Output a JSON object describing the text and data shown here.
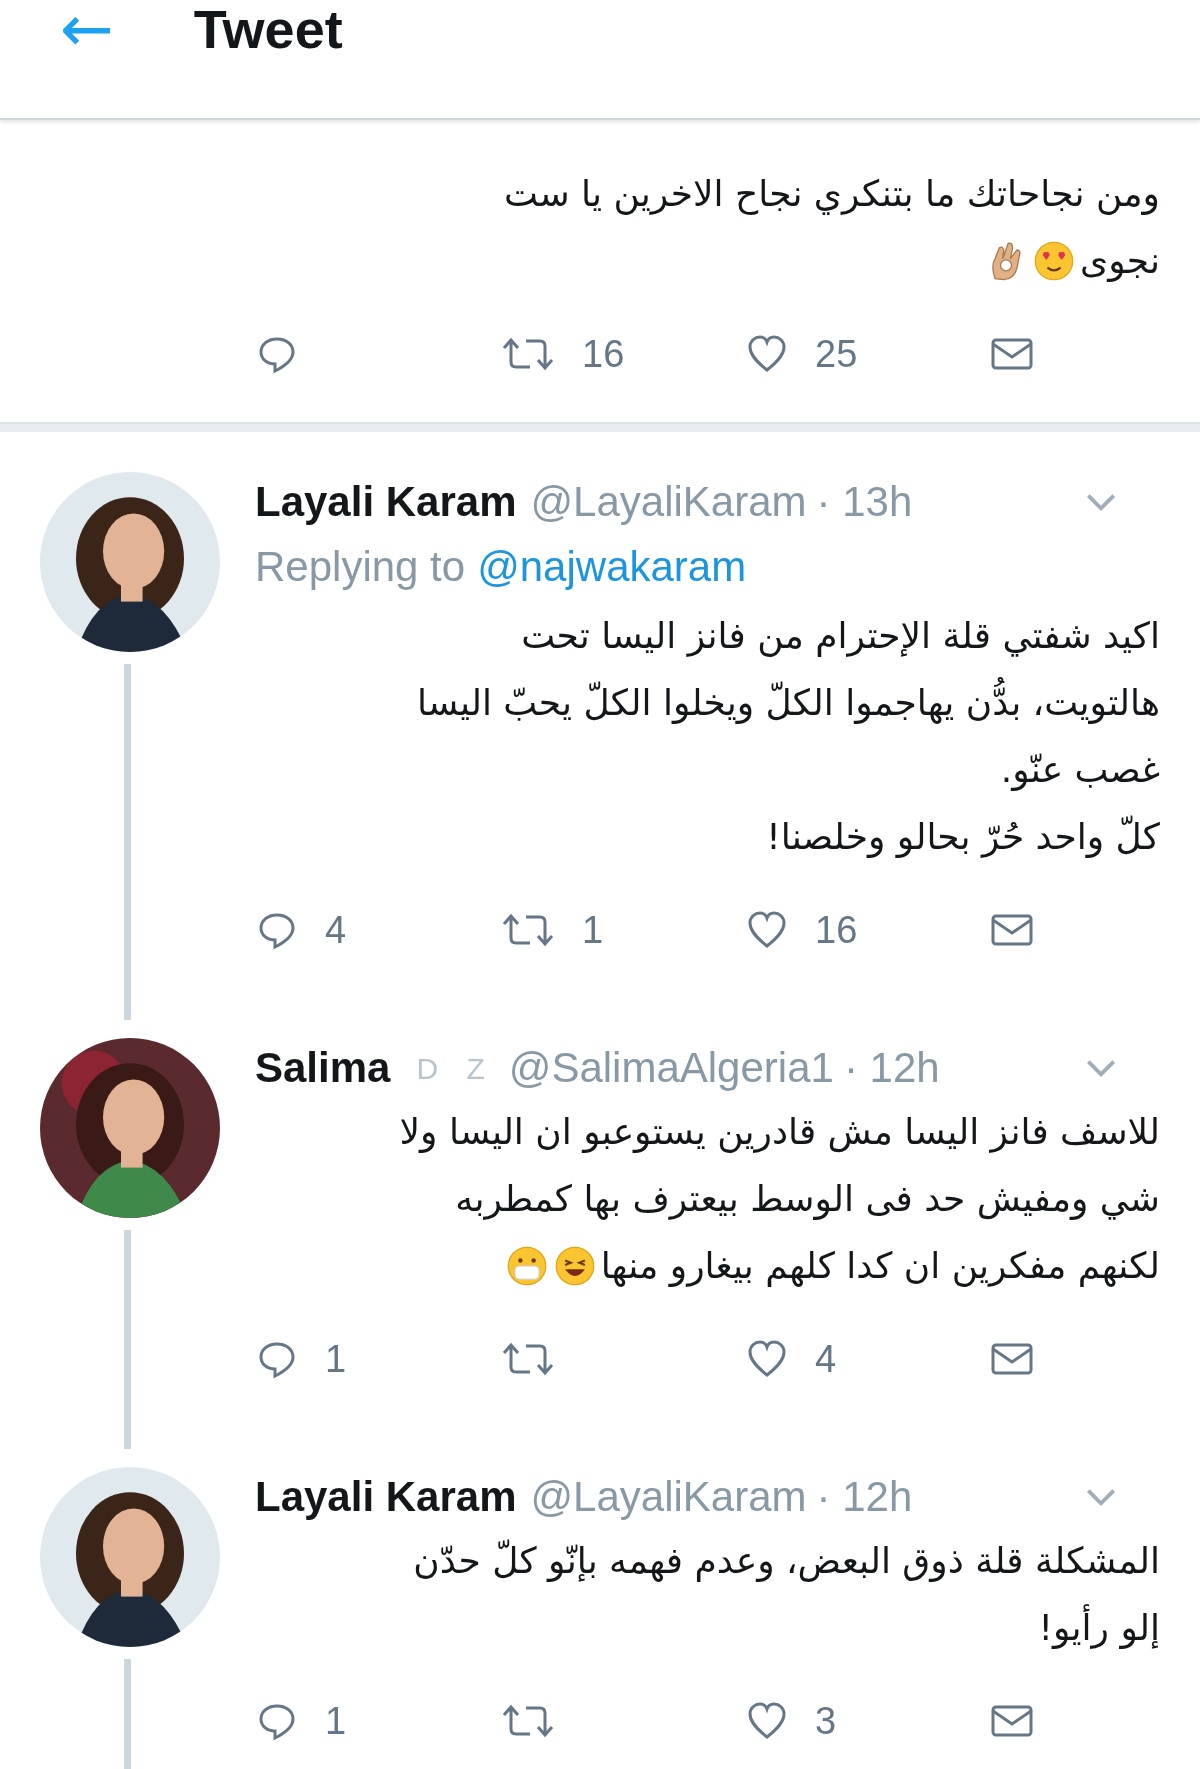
{
  "header": {
    "back": "←",
    "title": "Tweet"
  },
  "top_tweet": {
    "text": [
      "ومن نجاحاتك ما بتنكري نجاح الاخرين يا ست",
      "نجوى"
    ],
    "emojis": [
      {
        "kind": "heart_eyes"
      },
      {
        "kind": "ok_hand"
      }
    ],
    "retweet_count": "16",
    "like_count": "25"
  },
  "thread": [
    {
      "avatar": {
        "kind": "picture"
      },
      "name": "Layali Karam",
      "handle": "@LayaliKaram",
      "time": "· 13h",
      "replying_label": "Replying to",
      "replying_to": "@najwakaram",
      "text": [
        "اكيد شفتي قلة الإحترام من فانز اليسا تحت",
        "هالتويت، بدُّن يهاجموا الكلّ ويخلوا الكلّ يحبّ اليسا",
        "غصب عنّو.",
        "كلّ واحد حُرّ بحالو وخلصنا!"
      ],
      "reply_count": "4",
      "retweet_count": "1",
      "like_count": "16"
    },
    {
      "avatar": {
        "kind": "picture"
      },
      "name": "Salima",
      "badges": "D Z",
      "handle": "@SalimaAlgeria1",
      "time": "· 12h",
      "text": [
        "للاسف فانز اليسا مش قادرين يستوعبو ان اليسا ولا",
        "شي ومفيش حد فى الوسط بيعترف بها كمطربه",
        "لكنهم مفكرين ان كدا كلهم بيغارو منها"
      ],
      "emojis": [
        {
          "kind": "laughing"
        },
        {
          "kind": "mask"
        }
      ],
      "reply_count": "1",
      "like_count": "4"
    },
    {
      "avatar": {
        "kind": "picture"
      },
      "name": "Layali Karam",
      "handle": "@LayaliKaram",
      "time": "· 12h",
      "text": [
        "المشكلة قلة ذوق البعض، وعدم فهمه بإنّو كلّ حدّن",
        "إلو رأيو!"
      ],
      "reply_count": "1",
      "like_count": "3"
    }
  ]
}
